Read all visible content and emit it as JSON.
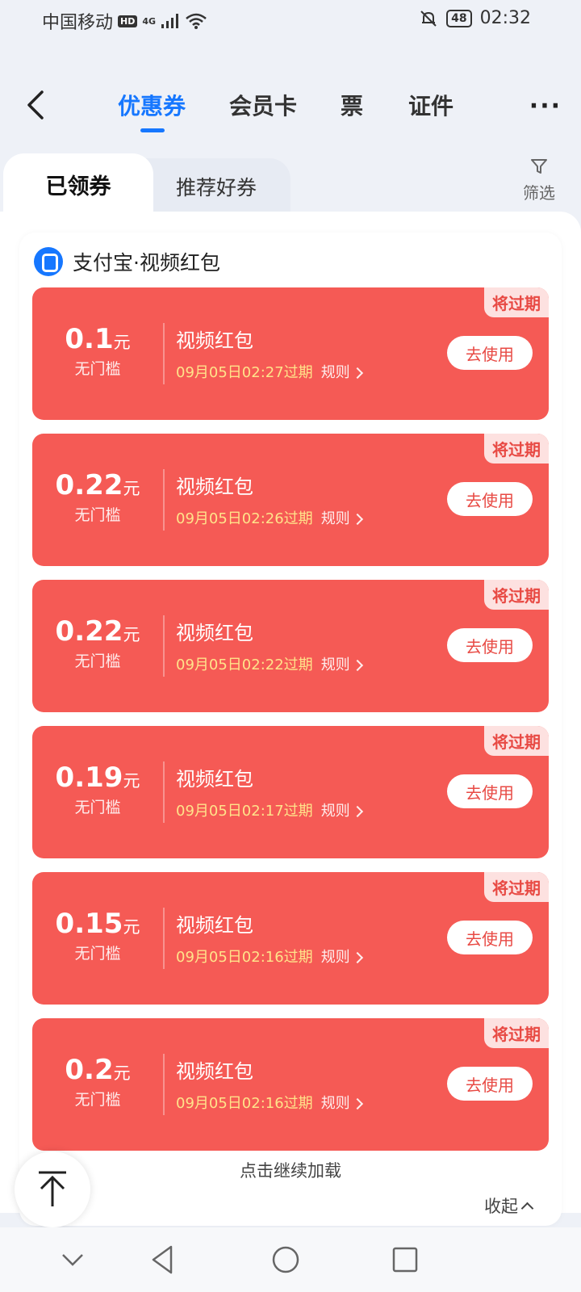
{
  "status_bar": {
    "carrier": "中国移动",
    "hd_badge": "HD",
    "network": "4G",
    "battery": "48",
    "time": "02:32"
  },
  "header": {
    "tabs": [
      {
        "label": "优惠券",
        "active": true
      },
      {
        "label": "会员卡",
        "active": false
      },
      {
        "label": "票",
        "active": false
      },
      {
        "label": "证件",
        "active": false
      }
    ],
    "more_label": "···"
  },
  "subtabs": {
    "active": "已领券",
    "inactive": "推荐好券",
    "filter_label": "筛选"
  },
  "panel": {
    "brand_name": "支付宝·视频红包",
    "coupons": [
      {
        "amount": "0.1",
        "unit": "元",
        "threshold": "无门槛",
        "title": "视频红包",
        "expiry": "09月05日02:27过期",
        "rule": "规则",
        "button": "去使用",
        "tag": "将过期"
      },
      {
        "amount": "0.22",
        "unit": "元",
        "threshold": "无门槛",
        "title": "视频红包",
        "expiry": "09月05日02:26过期",
        "rule": "规则",
        "button": "去使用",
        "tag": "将过期"
      },
      {
        "amount": "0.22",
        "unit": "元",
        "threshold": "无门槛",
        "title": "视频红包",
        "expiry": "09月05日02:22过期",
        "rule": "规则",
        "button": "去使用",
        "tag": "将过期"
      },
      {
        "amount": "0.19",
        "unit": "元",
        "threshold": "无门槛",
        "title": "视频红包",
        "expiry": "09月05日02:17过期",
        "rule": "规则",
        "button": "去使用",
        "tag": "将过期"
      },
      {
        "amount": "0.15",
        "unit": "元",
        "threshold": "无门槛",
        "title": "视频红包",
        "expiry": "09月05日02:16过期",
        "rule": "规则",
        "button": "去使用",
        "tag": "将过期"
      },
      {
        "amount": "0.2",
        "unit": "元",
        "threshold": "无门槛",
        "title": "视频红包",
        "expiry": "09月05日02:16过期",
        "rule": "规则",
        "button": "去使用",
        "tag": "将过期"
      }
    ],
    "load_more": "点击继续加载",
    "collapse": "收起"
  },
  "colors": {
    "accent": "#1677ff",
    "coupon_bg": "#f55a55",
    "expiry_text": "#ffe38a"
  }
}
